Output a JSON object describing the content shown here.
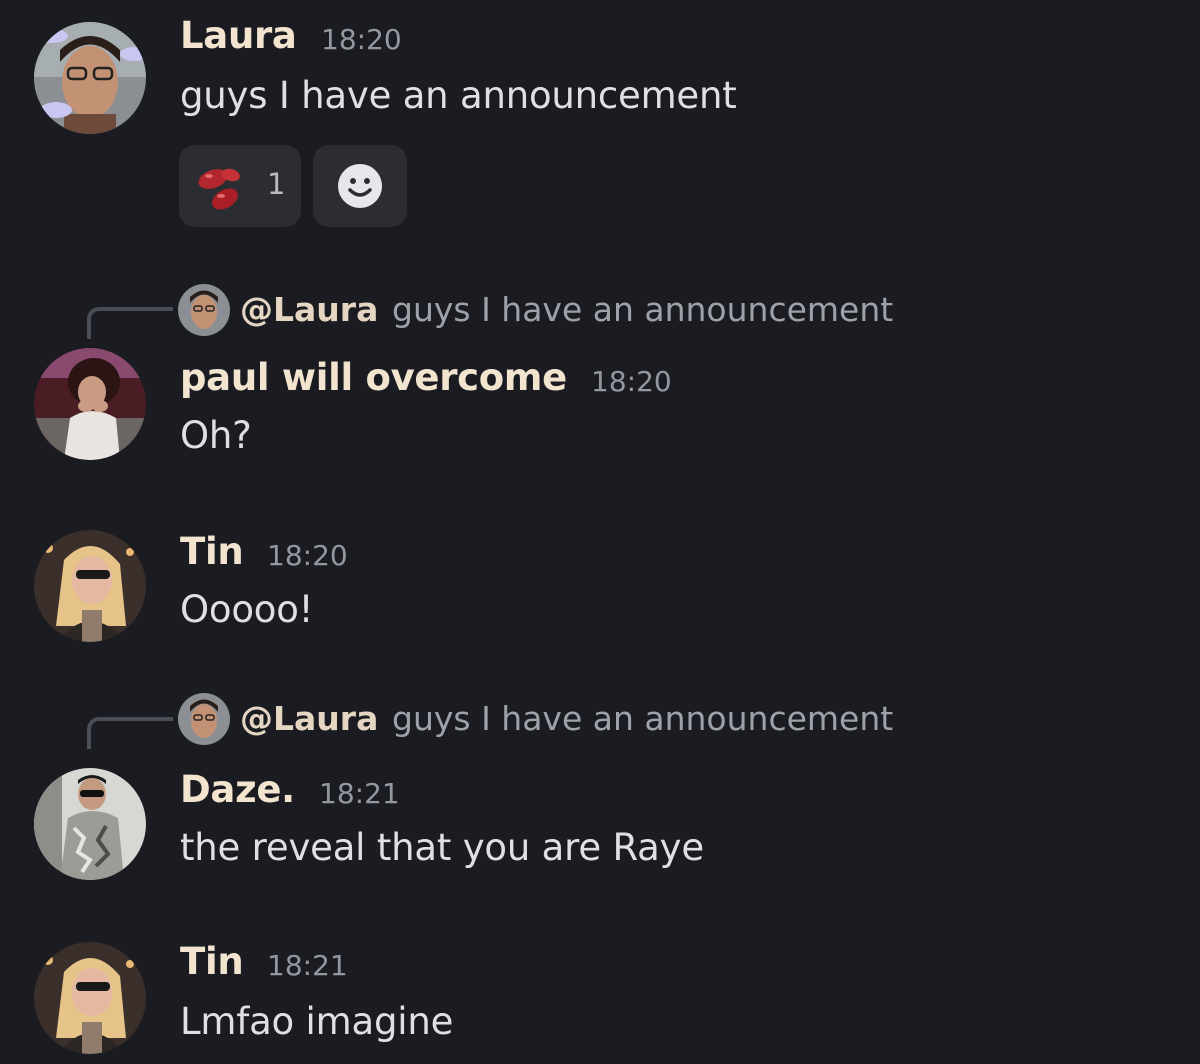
{
  "messages": [
    {
      "author": "Laura",
      "time": "18:20",
      "text": "guys I have an announcement",
      "reactions": [
        {
          "emoji": "beans",
          "count": "1"
        }
      ],
      "add_reaction_icon": "smile-icon"
    },
    {
      "reply": {
        "mention": "@Laura",
        "text": "guys I have an announcement"
      },
      "author": "paul will overcome",
      "time": "18:20",
      "text": "Oh?"
    },
    {
      "author": "Tin",
      "time": "18:20",
      "text": "Ooooo!"
    },
    {
      "reply": {
        "mention": "@Laura",
        "text": "guys I have an announcement"
      },
      "author": "Daze.",
      "time": "18:21",
      "text": "the reveal that you are Raye"
    },
    {
      "author": "Tin",
      "time": "18:21",
      "text": "Lmfao imagine"
    }
  ],
  "colors": {
    "background": "#1b1c21",
    "username": "#f2e4cf",
    "timestamp": "#9497a0",
    "message_text": "#dfe0e4",
    "reply_text": "#9ea1a9"
  }
}
